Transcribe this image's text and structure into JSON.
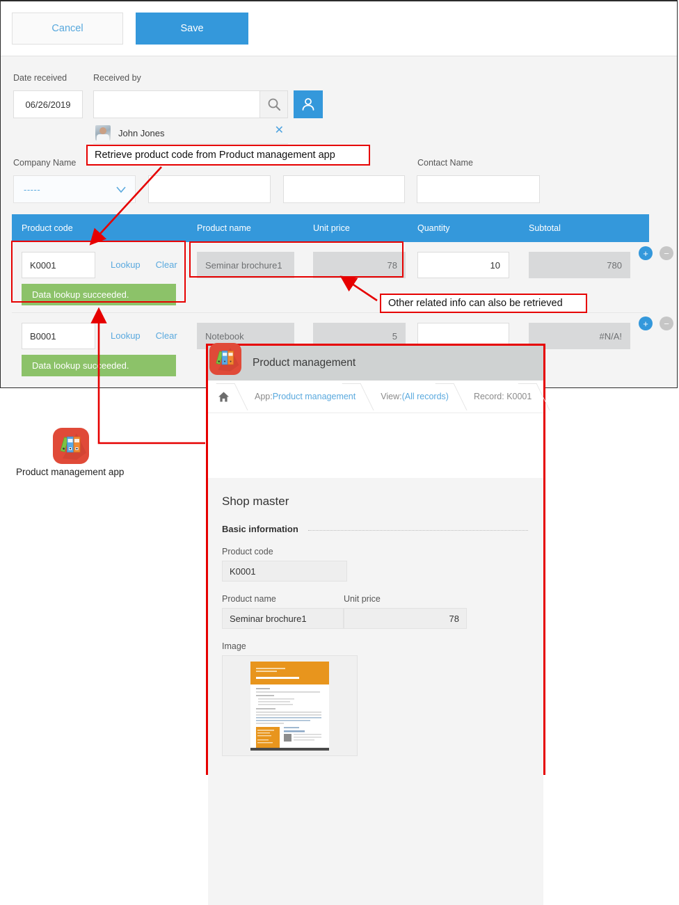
{
  "toolbar": {
    "cancel_label": "Cancel",
    "save_label": "Save",
    "accent": "#3498db"
  },
  "form": {
    "date_received_label": "Date received",
    "date_received_value": "06/26/2019",
    "received_by_label": "Received by",
    "received_by_value": "",
    "selected_user": "John Jones",
    "company_name_label": "Company Name",
    "company_name_value": "-----",
    "contact_name_label": "Contact Name",
    "field2_value": "",
    "field3_value": "",
    "contact_name_value": ""
  },
  "table": {
    "columns": [
      "Product code",
      "Product name",
      "Unit price",
      "Quantity",
      "Subtotal"
    ],
    "lookup_label": "Lookup",
    "clear_label": "Clear",
    "add_row_label": "+",
    "remove_row_label": "−",
    "rows": [
      {
        "product_code": "K0001",
        "status": "Data lookup succeeded.",
        "product_name": "Seminar brochure1",
        "unit_price": "78",
        "quantity": "10",
        "subtotal": "780"
      },
      {
        "product_code": "B0001",
        "status": "Data lookup succeeded.",
        "product_name": "Notebook",
        "unit_price": "5",
        "quantity": "",
        "subtotal": "#N/A!"
      }
    ]
  },
  "product_panel": {
    "title": "Product management",
    "breadcrumb": {
      "home": "home-icon",
      "app_prefix": "App: ",
      "app_name": "Product management",
      "view_prefix": "View: ",
      "view_name": "(All records)",
      "record": "Record: K0001"
    },
    "section_title": "Shop master",
    "subsection_title": "Basic information",
    "fields": {
      "product_code_label": "Product code",
      "product_code_value": "K0001",
      "product_name_label": "Product name",
      "product_name_value": "Seminar brochure1",
      "unit_price_label": "Unit price",
      "unit_price_value": "78",
      "image_label": "Image"
    }
  },
  "desktop": {
    "app_label": "Product management app",
    "icon": "product-management-app-icon"
  },
  "annotations": {
    "retrieve_note": "Retrieve product code from Product management app",
    "related_note": "Other related info can also be retrieved",
    "color": "#e60000"
  }
}
